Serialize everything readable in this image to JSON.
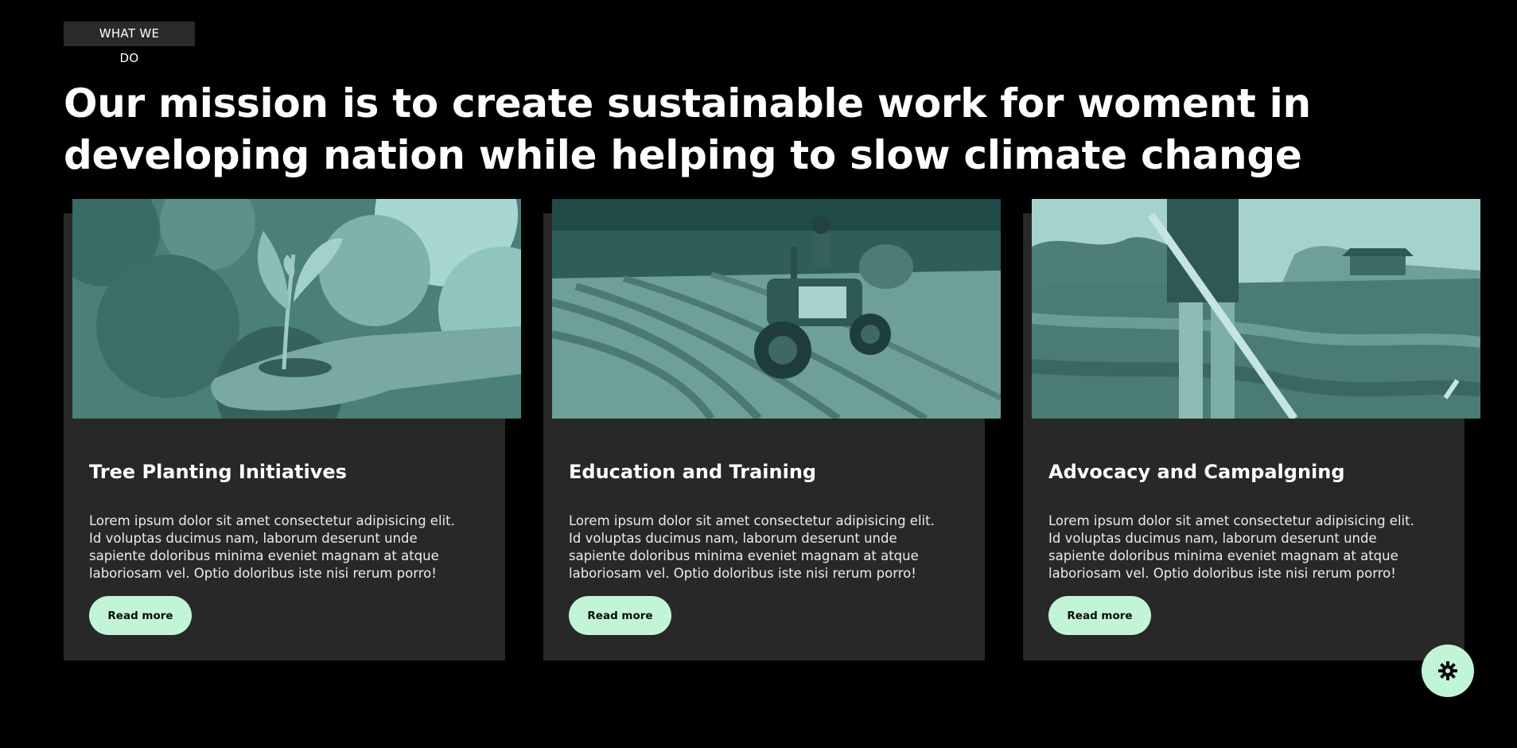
{
  "section": {
    "eyebrow": "WHAT WE DO",
    "headline": "Our mission is to create sustainable work for woment in developing nation while helping to slow climate change"
  },
  "cards": [
    {
      "image_subject": "seedling-in-hand",
      "title": "Tree Planting Initiatives",
      "body": "Lorem ipsum dolor sit amet consectetur adipisicing elit. Id voluptas ducimus nam, laborum deserunt unde sapiente doloribus minima eveniet magnam at atque laboriosam vel. Optio doloribus iste nisi rerum porro!",
      "button_label": "Read more"
    },
    {
      "image_subject": "tractor-plowing-field",
      "title": "Education and Training",
      "body": "Lorem ipsum dolor sit amet consectetur adipisicing elit. Id voluptas ducimus nam, laborum deserunt unde sapiente doloribus minima eveniet magnam at atque laboriosam vel. Optio doloribus iste nisi rerum porro!",
      "button_label": "Read more"
    },
    {
      "image_subject": "farmer-with-hoe",
      "title": "Advocacy and Campalgning",
      "body": "Lorem ipsum dolor sit amet consectetur adipisicing elit. Id voluptas ducimus nam, laborum deserunt unde sapiente doloribus minima eveniet magnam at atque laboriosam vel. Optio doloribus iste nisi rerum porro!",
      "button_label": "Read more"
    }
  ],
  "fab": {
    "icon": "gear-icon"
  },
  "colors": {
    "background": "#000000",
    "card": "#282828",
    "accent": "#c2f5d7",
    "image_tint": "#3d6d67"
  }
}
